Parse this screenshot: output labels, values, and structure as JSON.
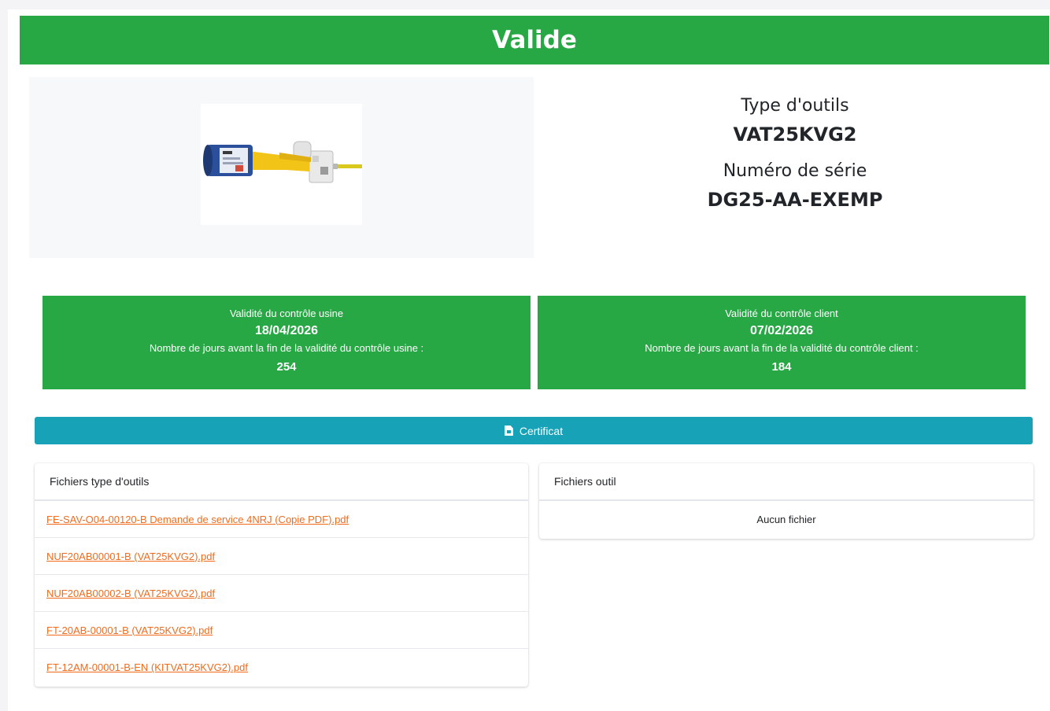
{
  "banner": {
    "status": "Valide"
  },
  "tool": {
    "type_label": "Type d'outils",
    "type_value": "VAT25KVG2",
    "serial_label": "Numéro de série",
    "serial_value": "DG25-AA-EXEMP"
  },
  "validity_usine": {
    "title": "Validité du contrôle usine",
    "date": "18/04/2026",
    "subtitle": "Nombre de jours avant la fin de la validité du contrôle usine :",
    "days": "254"
  },
  "validity_client": {
    "title": "Validité du contrôle client",
    "date": "07/02/2026",
    "subtitle": "Nombre de jours avant la fin de la validité du contrôle client :",
    "days": "184"
  },
  "certificate_button": {
    "label": "Certificat",
    "icon": "file-pdf-icon"
  },
  "files_type": {
    "header": "Fichiers type d'outils",
    "files": [
      "FE-SAV-O04-00120-B  Demande de service 4NRJ (Copie PDF).pdf",
      "NUF20AB00001-B (VAT25KVG2).pdf",
      "NUF20AB00002-B (VAT25KVG2).pdf",
      "FT-20AB-00001-B (VAT25KVG2).pdf",
      "FT-12AM-00001-B-EN (KITVAT25KVG2).pdf"
    ]
  },
  "files_tool": {
    "header": "Fichiers outil",
    "empty_text": "Aucun fichier"
  },
  "colors": {
    "valid_green": "#28a745",
    "button_teal": "#17a2b8",
    "link_orange": "#f26b1d"
  }
}
